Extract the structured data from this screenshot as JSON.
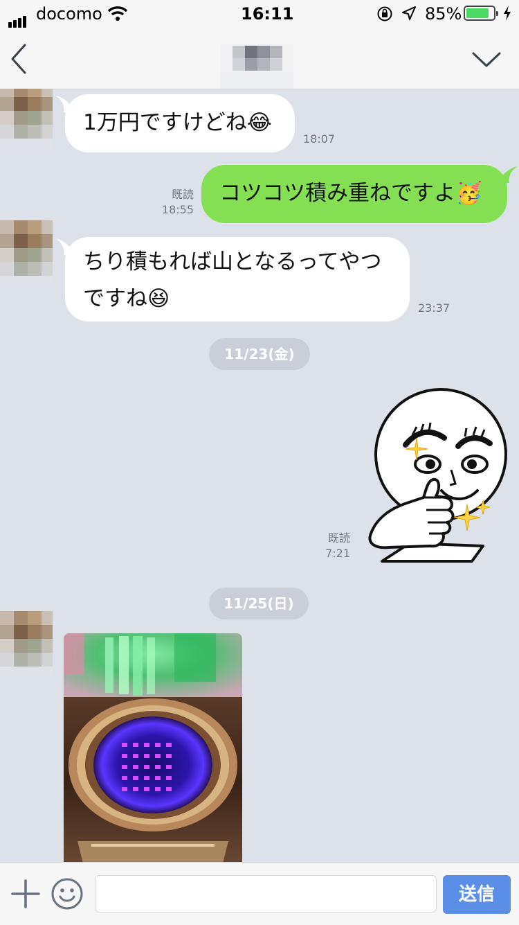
{
  "status_bar": {
    "carrier": "docomo",
    "time": "16:11",
    "battery_pct": "85%",
    "battery_level": 0.85,
    "icons": [
      "signal-icon",
      "wifi-icon",
      "orientation-lock-icon",
      "location-icon",
      "battery-icon",
      "charging-icon"
    ]
  },
  "nav": {
    "back_icon": "chevron-left-icon",
    "menu_icon": "chevron-down-icon"
  },
  "messages": [
    {
      "side": "in",
      "text": "1万円ですけどね😂",
      "time": "18:07"
    },
    {
      "side": "out",
      "text": "コツコツ積み重ねですよ🥳",
      "read": "既読",
      "time": "18:55"
    },
    {
      "side": "in",
      "text_line1": "ちり積もれば山となるってやつ",
      "text_line2": "ですね😆",
      "time": "23:37"
    },
    {
      "side": "out",
      "type": "sticker",
      "read": "既読",
      "time": "7:21"
    },
    {
      "side": "in",
      "type": "photo"
    }
  ],
  "dates": [
    "11/23(金)",
    "11/25(日)"
  ],
  "input": {
    "placeholder": "",
    "send_label": "送信",
    "plus_icon": "plus-icon",
    "emoji_icon": "smiley-icon"
  },
  "colors": {
    "chat_bg": "#dde1ea",
    "outgoing_bubble": "#84e052",
    "incoming_bubble": "#ffffff",
    "send_button": "#5b8ee6",
    "date_pill": "#c9ced8"
  }
}
